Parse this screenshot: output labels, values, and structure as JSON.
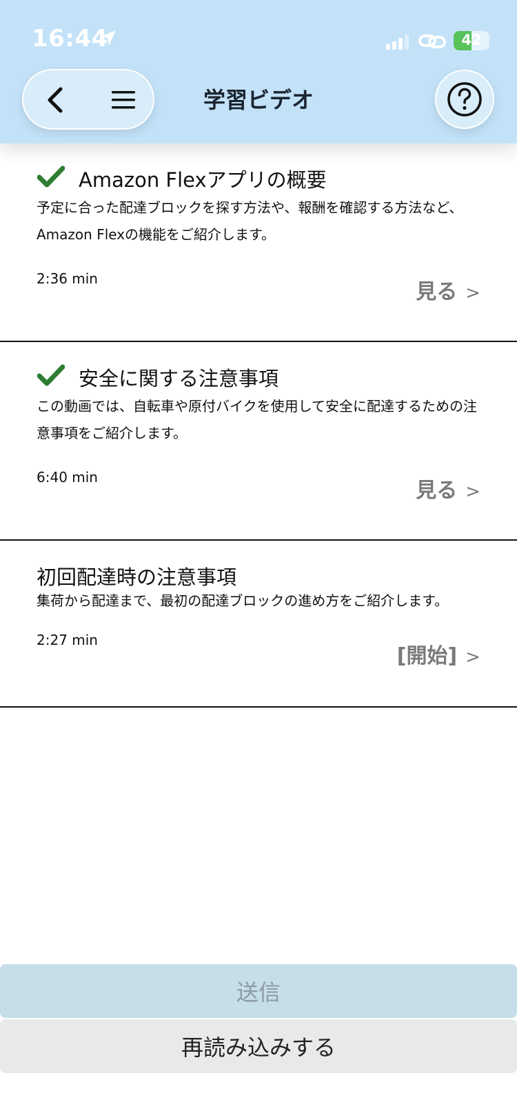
{
  "status_bar": {
    "time": "16:44",
    "battery": "42"
  },
  "header": {
    "title": "学習ビデオ"
  },
  "videos": [
    {
      "completed": true,
      "title": "Amazon Flexアプリの概要",
      "description": "予定に合った配達ブロックを探す方法や、報酬を確認する方法など、Amazon Flexの機能をご紹介します。",
      "duration": "2:36 min",
      "action": "見る",
      "chevron": ">"
    },
    {
      "completed": true,
      "title": "安全に関する注意事項",
      "description": "この動画では、自転車や原付バイクを使用して安全に配達するための注意事項をご紹介します。",
      "duration": "6:40 min",
      "action": "見る",
      "chevron": ">"
    },
    {
      "completed": false,
      "title": "初回配達時の注意事項",
      "description": "集荷から配達まで、最初の配達ブロックの進め方をご紹介します。",
      "duration": "2:27 min",
      "action": "[開始]",
      "chevron": ">"
    }
  ],
  "footer": {
    "submit_label": "送信",
    "reload_label": "再読み込みする"
  },
  "colors": {
    "header_bg": "#c3e2f8",
    "check": "#2e7d32",
    "action_text": "#7a7a7a",
    "submit_bg": "#c6dee8",
    "reload_bg": "#e8eaea"
  }
}
